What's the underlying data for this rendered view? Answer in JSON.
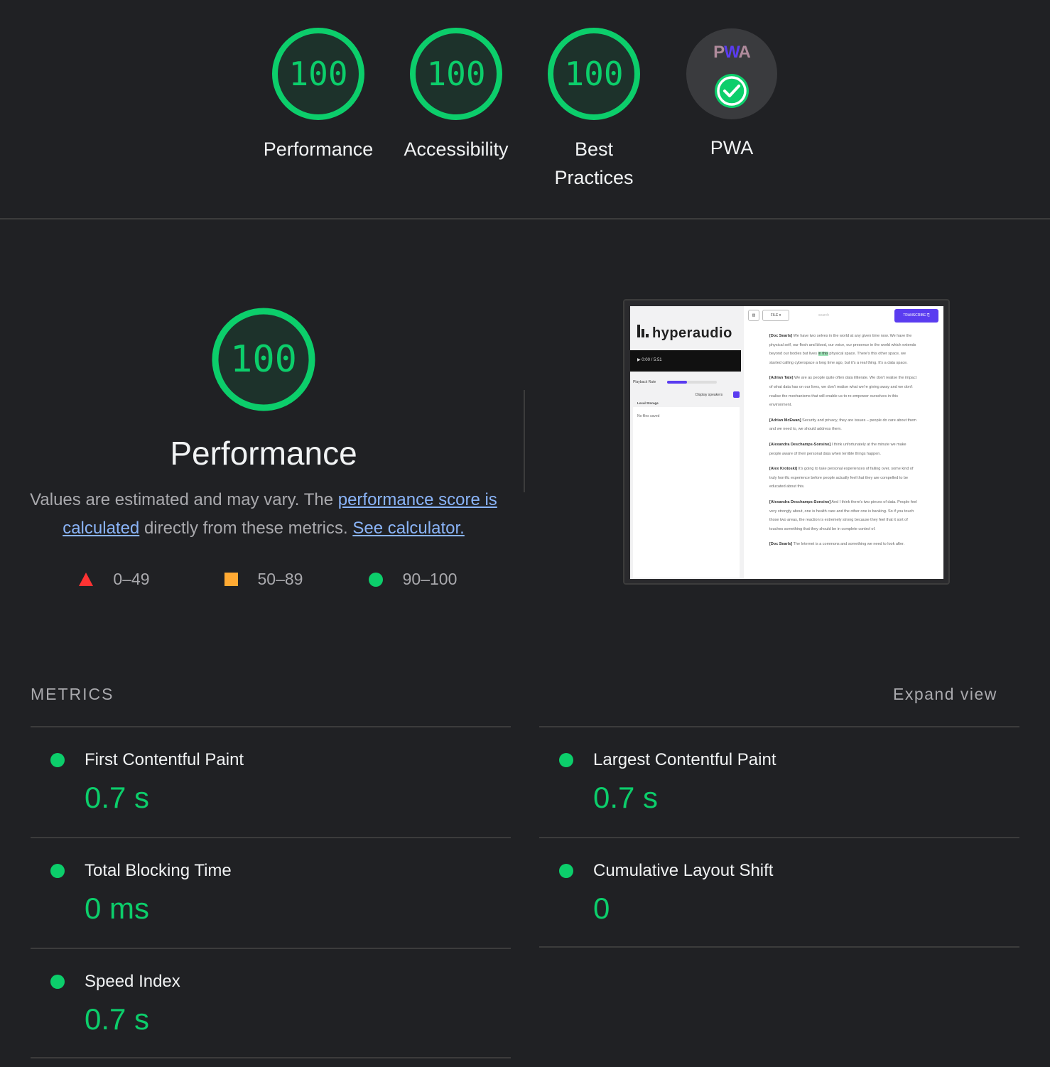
{
  "gauges": [
    {
      "label": "Performance",
      "score": "100"
    },
    {
      "label": "Accessibility",
      "score": "100"
    },
    {
      "label": "Best Practices",
      "score": "100"
    },
    {
      "label": "PWA",
      "badge_text": "PWA"
    }
  ],
  "performance": {
    "score": "100",
    "title": "Performance",
    "desc_prefix": "Values are estimated and may vary. The ",
    "desc_link1": "performance score is calculated",
    "desc_middle": " directly from these metrics. ",
    "desc_link2": "See calculator."
  },
  "legend": [
    {
      "range": "0–49",
      "shape": "triangle",
      "color": "#ff3333"
    },
    {
      "range": "50–89",
      "shape": "square",
      "color": "#ffaa33"
    },
    {
      "range": "90–100",
      "shape": "circle",
      "color": "#0cce6b"
    }
  ],
  "screenshot": {
    "logo": "hyperaudio",
    "player_time": "0:00 / 5:51",
    "playback_label": "Playback Rate",
    "display_speakers": "Display speakers",
    "local_storage": "Local Storage",
    "no_files": "No files saved",
    "file_btn": "FILE",
    "search_placeholder": "search",
    "transcribe_btn": "TRANSCRIBE",
    "paragraphs": [
      {
        "speaker": "[Doc Searls]",
        "pre": " We have two selves in the world at any given time now. We have the physical self, our flesh and blood, our voice, our presence in the world which extends beyond our bodies but lives ",
        "hl": "in this",
        "post": " physical space. There's this other space, we started calling cyberspace a long time ago, but it's a real thing. It's a data space."
      },
      {
        "speaker": "[Adrian Tate]",
        "pre": " We are as people quite often data illiterate. We don't realise the impact of what data has on our lives, we don't realise what we're giving away and we don't realise the mechanisms that will enable us to re-empower ourselves in this environment.",
        "hl": "",
        "post": ""
      },
      {
        "speaker": "[Adrian McEwan]",
        "pre": " Security and privacy, they are issues – people do care about them and we need to, we should address them.",
        "hl": "",
        "post": ""
      },
      {
        "speaker": "[Alexandra Deschamps-Sonsino]",
        "pre": " I think unfortunately at the minute we make people aware of their personal data when terrible things happen.",
        "hl": "",
        "post": ""
      },
      {
        "speaker": "[Alex Krotoski]",
        "pre": " It's going to take personal experiences of failing over, some kind of truly horrific experience before people actually feel that they are compelled to be educated about this.",
        "hl": "",
        "post": ""
      },
      {
        "speaker": "[Alexandra Deschamps-Sonsino]",
        "pre": " And I think there's two pieces of data. People feel very strongly about, one is health care and the other one is banking. So if you touch those two areas, the reaction is extremely strong because they feel that it sort of touches something that they should be in complete control of.",
        "hl": "",
        "post": ""
      },
      {
        "speaker": "[Doc Searls]",
        "pre": " The Internet is a commons and something we need to look after.",
        "hl": "",
        "post": ""
      }
    ]
  },
  "metrics": {
    "header": "METRICS",
    "expand_label": "Expand view",
    "items": [
      {
        "name": "First Contentful Paint",
        "value": "0.7 s"
      },
      {
        "name": "Largest Contentful Paint",
        "value": "0.7 s"
      },
      {
        "name": "Total Blocking Time",
        "value": "0 ms"
      },
      {
        "name": "Cumulative Layout Shift",
        "value": "0"
      },
      {
        "name": "Speed Index",
        "value": "0.7 s"
      }
    ]
  },
  "colors": {
    "pass": "#0cce6b",
    "background": "#202124",
    "link": "#8ab4f8",
    "pwa_accent": "#5a3cf0"
  }
}
